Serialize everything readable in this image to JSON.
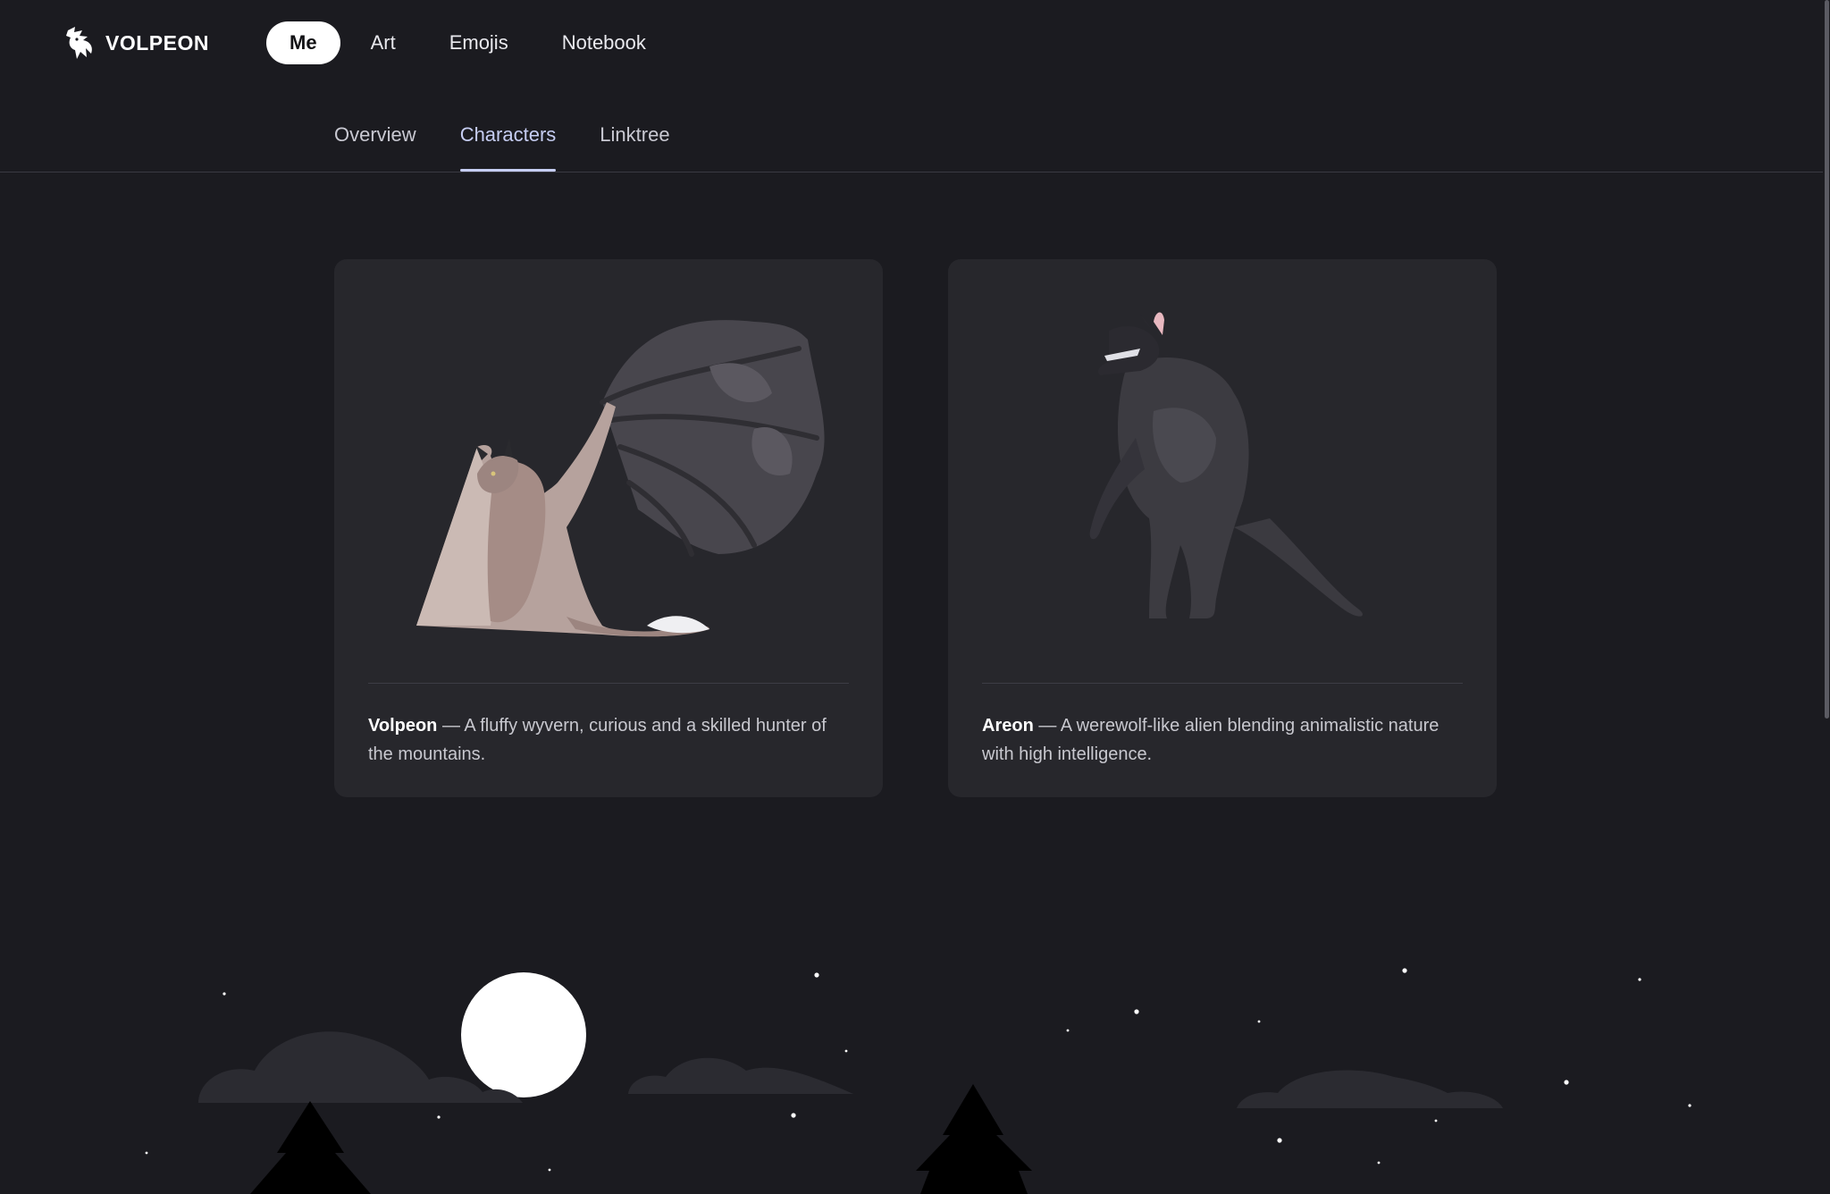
{
  "brand": {
    "name": "VOLPEON"
  },
  "main_nav": [
    {
      "label": "Me",
      "active": true
    },
    {
      "label": "Art",
      "active": false
    },
    {
      "label": "Emojis",
      "active": false
    },
    {
      "label": "Notebook",
      "active": false
    }
  ],
  "sub_tabs": [
    {
      "label": "Overview",
      "active": false
    },
    {
      "label": "Characters",
      "active": true
    },
    {
      "label": "Linktree",
      "active": false
    }
  ],
  "characters": [
    {
      "name": "Volpeon",
      "description": " — A fluffy wyvern, curious and a skilled hunter of the mountains."
    },
    {
      "name": "Areon",
      "description": " — A werewolf-like alien blending animalistic nature with high intelligence."
    }
  ],
  "colors": {
    "background": "#1b1b20",
    "card": "#27272c",
    "accent": "#c6cdf2",
    "active_pill": "#ffffff"
  }
}
